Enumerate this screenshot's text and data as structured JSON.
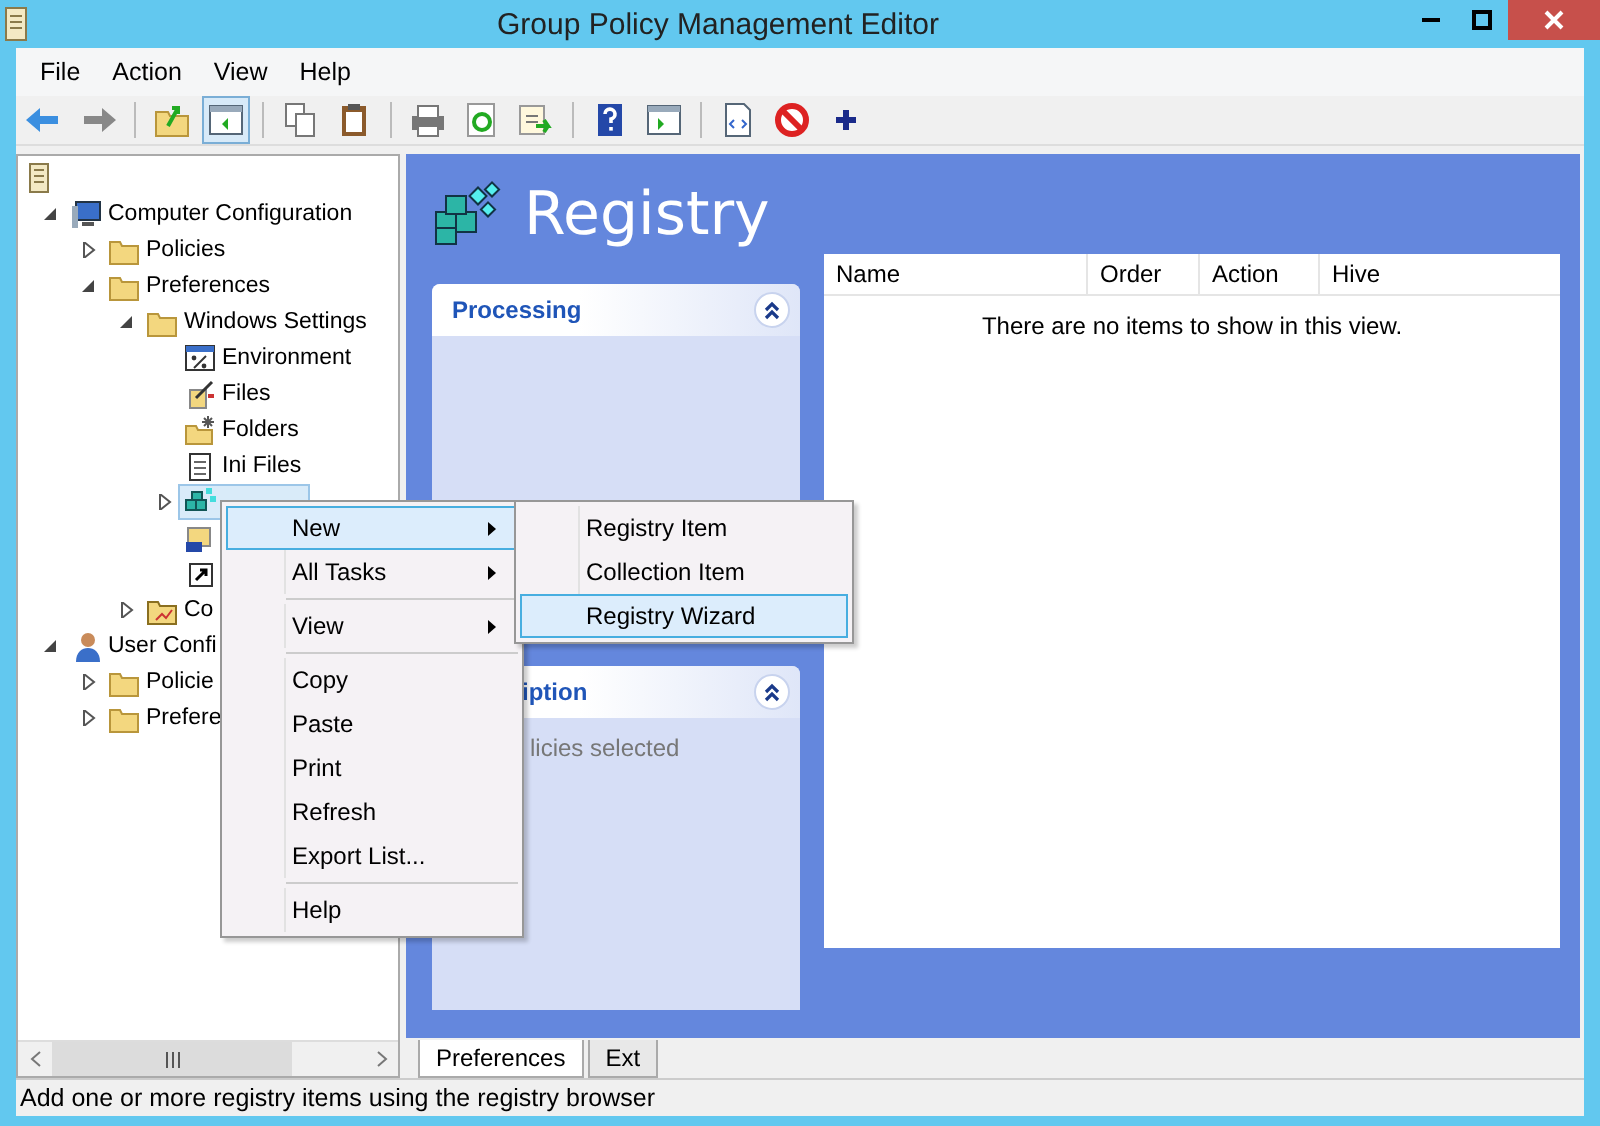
{
  "window": {
    "title": "Group Policy Management Editor"
  },
  "menu_bar": [
    "File",
    "Action",
    "View",
    "Help"
  ],
  "toolbar": [
    {
      "kind": "back",
      "pressed": false
    },
    {
      "kind": "forward",
      "pressed": false
    },
    {
      "kind": "sep"
    },
    {
      "kind": "up",
      "pressed": false
    },
    {
      "kind": "tree",
      "pressed": true
    },
    {
      "kind": "sep"
    },
    {
      "kind": "copy",
      "pressed": false
    },
    {
      "kind": "paste",
      "pressed": false
    },
    {
      "kind": "sep"
    },
    {
      "kind": "print",
      "pressed": false
    },
    {
      "kind": "refresh",
      "pressed": false
    },
    {
      "kind": "export",
      "pressed": false
    },
    {
      "kind": "sep"
    },
    {
      "kind": "help",
      "pressed": false
    },
    {
      "kind": "console",
      "pressed": false
    },
    {
      "kind": "sep"
    },
    {
      "kind": "properties",
      "pressed": false
    },
    {
      "kind": "stop",
      "pressed": false
    },
    {
      "kind": "plus",
      "pressed": false
    }
  ],
  "tree": [
    {
      "kind": "doc",
      "selected": false,
      "children": [
        {
          "kind": "computer",
          "label": "Computer Configuration",
          "expanded": true,
          "selected": false,
          "children": [
            {
              "kind": "folder",
              "label": "Policies",
              "expanded": false,
              "selected": false
            },
            {
              "kind": "folder",
              "label": "Preferences",
              "expanded": true,
              "selected": false,
              "children": [
                {
                  "kind": "folder",
                  "label": "Windows Settings",
                  "expanded": true,
                  "selected": false,
                  "children": [
                    {
                      "kind": "env",
                      "label": "Environment",
                      "selected": false
                    },
                    {
                      "kind": "files",
                      "label": "Files",
                      "selected": false
                    },
                    {
                      "kind": "folders",
                      "label": "Folders",
                      "selected": false
                    },
                    {
                      "kind": "ini",
                      "label": "Ini Files",
                      "selected": false
                    },
                    {
                      "kind": "registry",
                      "expanded": false,
                      "selected": true
                    },
                    {
                      "kind": "drive",
                      "selected": false
                    },
                    {
                      "kind": "shortcut",
                      "selected": false
                    }
                  ]
                },
                {
                  "kind": "panel",
                  "label": "Co",
                  "expanded": false,
                  "selected": false
                }
              ]
            }
          ]
        },
        {
          "kind": "user",
          "label": "User Confi",
          "expanded": true,
          "selected": false,
          "children": [
            {
              "kind": "folder",
              "label": "Policie",
              "expanded": false,
              "selected": false
            },
            {
              "kind": "folder",
              "label": "Prefere",
              "expanded": false,
              "selected": false
            }
          ]
        }
      ]
    }
  ],
  "content": {
    "title": "Registry",
    "panels": [
      {
        "title": "Processing",
        "expanded": true
      },
      {
        "title": "iption",
        "text": "licies selected",
        "expanded": true
      }
    ],
    "list": {
      "columns": [
        "Name",
        "Order",
        "Action",
        "Hive"
      ],
      "empty_message": "There are no items to show in this view."
    },
    "tabs": [
      {
        "label": "Preferences",
        "selected": true
      },
      {
        "label": "Ext",
        "selected": false
      }
    ]
  },
  "context_menu": {
    "items": [
      {
        "kind": "item",
        "label": "New",
        "submenu": true,
        "selected": true
      },
      {
        "kind": "item",
        "label": "All Tasks",
        "submenu": true,
        "selected": false
      },
      {
        "kind": "separator"
      },
      {
        "kind": "item",
        "label": "View",
        "submenu": true,
        "selected": false
      },
      {
        "kind": "separator"
      },
      {
        "kind": "item",
        "label": "Copy",
        "submenu": false,
        "selected": false
      },
      {
        "kind": "item",
        "label": "Paste",
        "submenu": false,
        "selected": false
      },
      {
        "kind": "item",
        "label": "Print",
        "submenu": false,
        "selected": false
      },
      {
        "kind": "item",
        "label": "Refresh",
        "submenu": false,
        "selected": false
      },
      {
        "kind": "item",
        "label": "Export List...",
        "submenu": false,
        "selected": false
      },
      {
        "kind": "separator"
      },
      {
        "kind": "item",
        "label": "Help",
        "submenu": false,
        "selected": false
      }
    ]
  },
  "submenu": {
    "items": [
      {
        "label": "Registry Item",
        "selected": false
      },
      {
        "label": "Collection Item",
        "selected": false
      },
      {
        "label": "Registry Wizard",
        "selected": true
      }
    ]
  },
  "status_bar": "Add one or more registry items using the registry browser"
}
